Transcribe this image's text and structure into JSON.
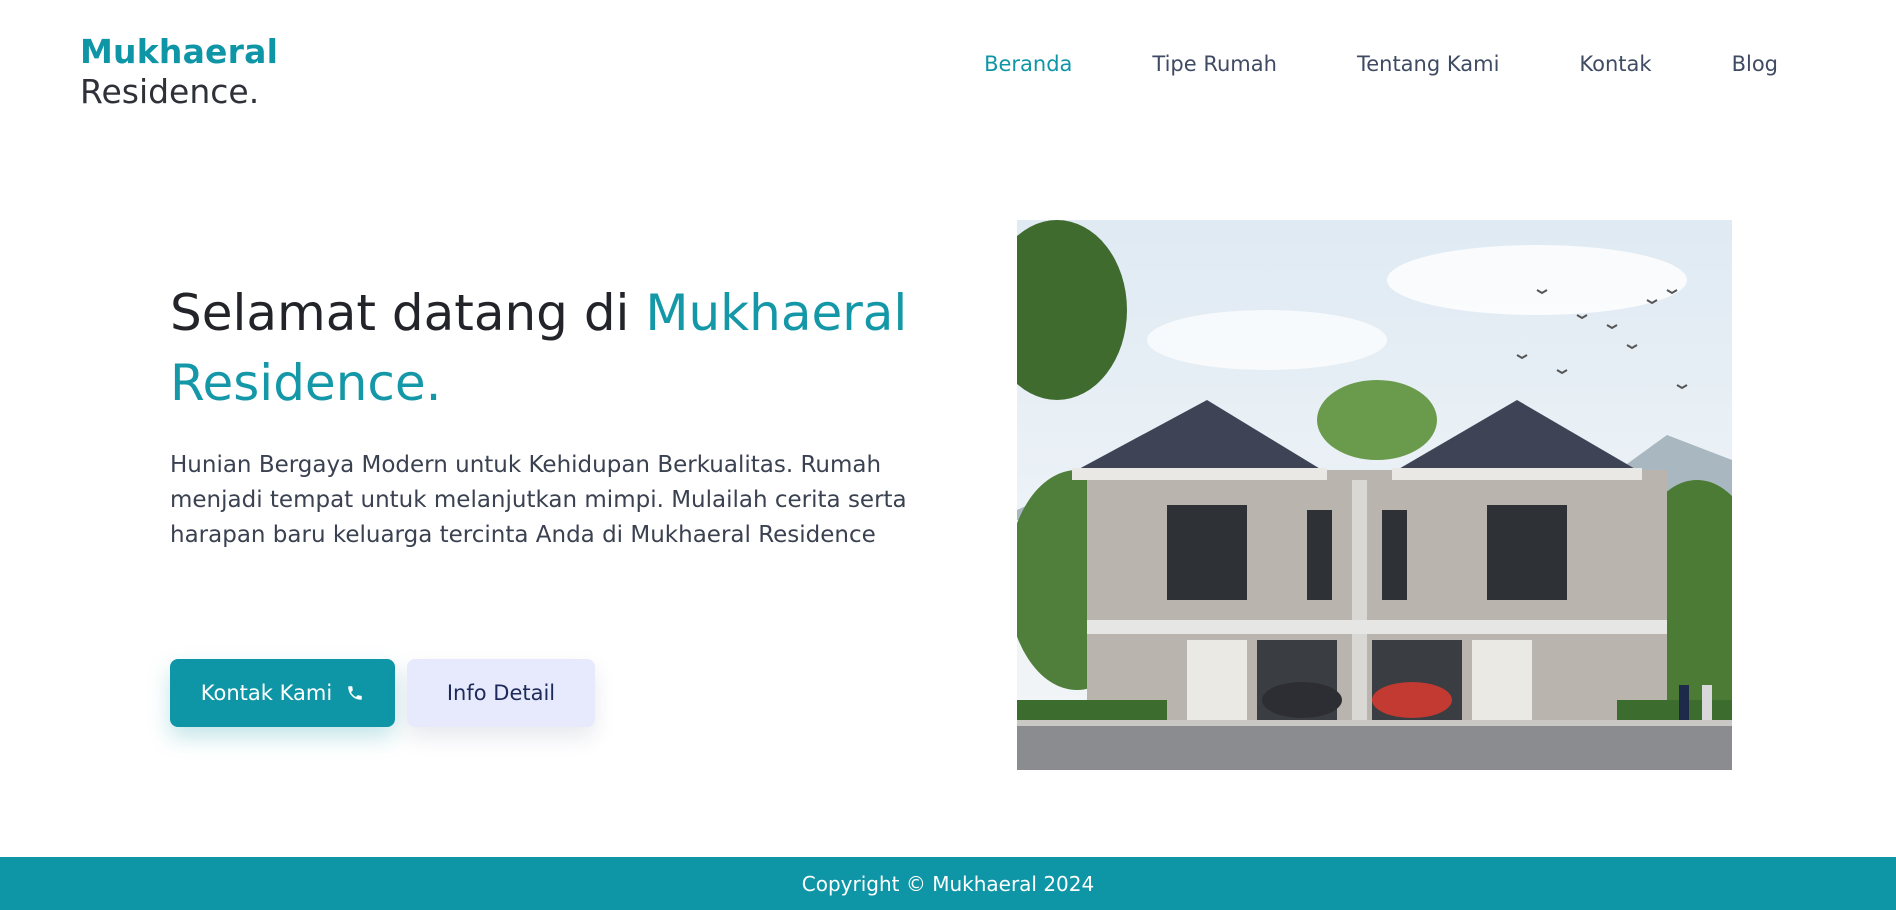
{
  "brand": {
    "line1": "Mukhaeral",
    "line2": "Residence."
  },
  "nav": {
    "items": [
      {
        "label": "Beranda",
        "active": true
      },
      {
        "label": "Tipe Rumah",
        "active": false
      },
      {
        "label": "Tentang Kami",
        "active": false
      },
      {
        "label": "Kontak",
        "active": false
      },
      {
        "label": "Blog",
        "active": false
      }
    ]
  },
  "hero": {
    "title_prefix": "Selamat datang di ",
    "title_accent": "Mukhaeral Residence.",
    "description": "Hunian Bergaya Modern untuk Kehidupan Berkualitas. Rumah menjadi tempat untuk melanjutkan mimpi. Mulailah cerita serta harapan baru keluarga tercinta Anda di Mukhaeral Residence",
    "primary_button": {
      "label": "Kontak Kami",
      "icon": "phone-icon"
    },
    "secondary_button": {
      "label": "Info Detail"
    },
    "image_subject": "house-illustration"
  },
  "footer": {
    "copyright": "Copyright © Mukhaeral 2024"
  },
  "colors": {
    "accent": "#0f96a6",
    "text_dark": "#23242a",
    "nav_text": "#3f4a63",
    "secondary_bg": "#e6eafc"
  }
}
